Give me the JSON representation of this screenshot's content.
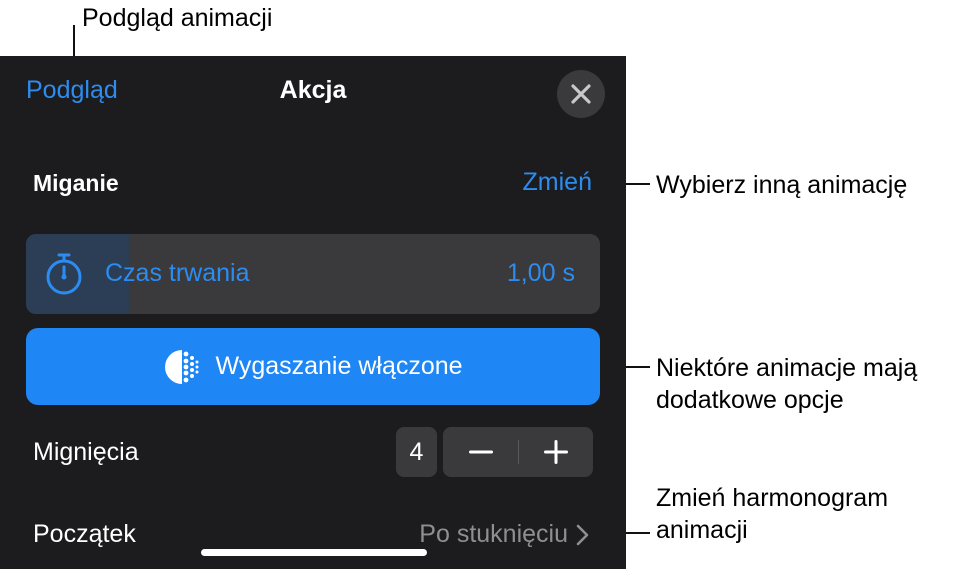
{
  "callouts": {
    "preview": "Podgląd animacji",
    "change": "Wybierz inną animację",
    "options_line1": "Niektóre animacje mają",
    "options_line2": "dodatkowe opcje",
    "schedule_line1": "Zmień harmonogram",
    "schedule_line2": "animacji"
  },
  "header": {
    "preview_label": "Podgląd",
    "title": "Akcja",
    "close_icon": "close-icon"
  },
  "animation": {
    "name": "Miganie",
    "change_label": "Zmień"
  },
  "duration": {
    "icon": "timer-icon",
    "label": "Czas trwania",
    "value": "1,00 s",
    "slider_fraction": 0.18
  },
  "fade_button": {
    "icon": "fade-icon",
    "label": "Wygaszanie włączone"
  },
  "blinks": {
    "label": "Mignięcia",
    "value": "4"
  },
  "start": {
    "label": "Początek",
    "value": "Po stuknięciu"
  },
  "colors": {
    "accent": "#2d8cf0",
    "panel_bg": "#1c1c1e",
    "control_bg": "#3a3a3c",
    "button_blue": "#1e86f5"
  }
}
